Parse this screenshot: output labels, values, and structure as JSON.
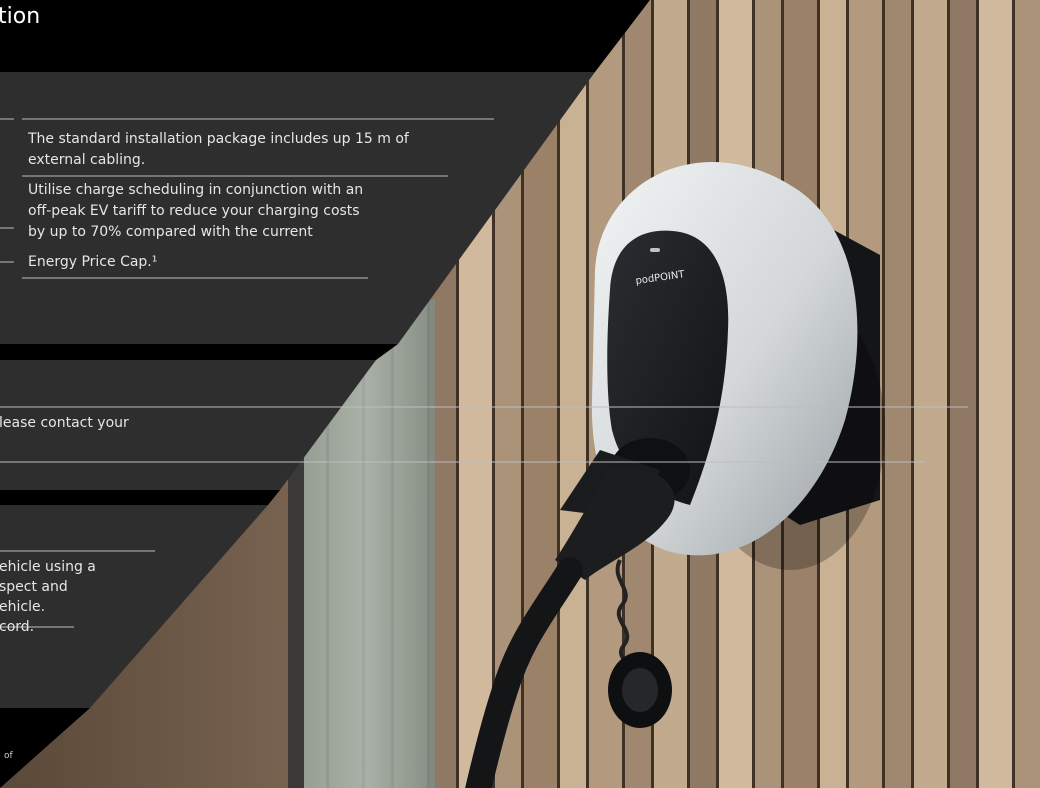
{
  "page": {
    "title_fragment": "tion",
    "panel1": {
      "para1": [
        "The standard installation package includes up 15 m of",
        "external cabling."
      ],
      "para2": [
        "Utilise charge scheduling in conjunction with an",
        "off-peak EV tariff to reduce your charging costs",
        "by up to 70% compared with the current",
        "Energy Price Cap.¹"
      ]
    },
    "panel2": {
      "lines": [
        "lease contact your"
      ]
    },
    "panel3": {
      "lines": [
        "ehicle using a",
        "spect and",
        "ehicle.",
        "cord."
      ]
    },
    "footnote_fragment": "of"
  },
  "charger": {
    "brand_text": "podPOINT"
  },
  "colors": {
    "panel": "#2e2e2e",
    "band": "#000000",
    "text": "#e6e6e6",
    "rule": "#bdbdbd",
    "charger_shell": "#dcdfe1",
    "charger_face": "#1b1d20",
    "wood_light": "#c9b194",
    "wood_dark": "#6d5a48"
  }
}
